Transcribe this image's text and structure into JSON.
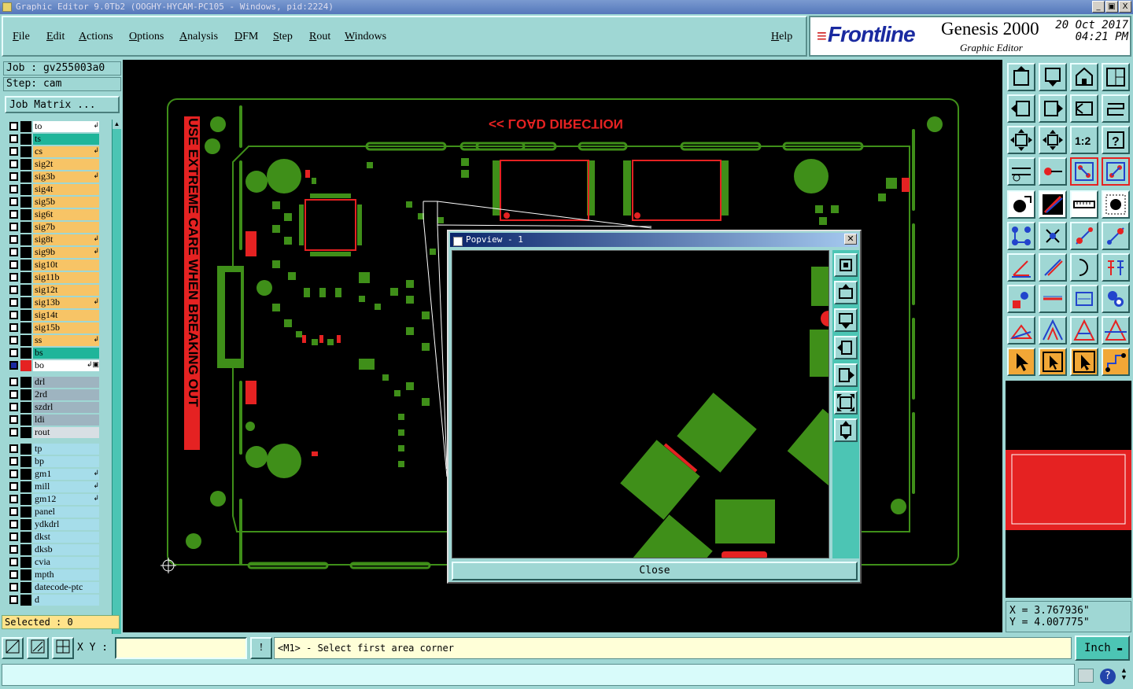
{
  "window": {
    "title": "Graphic Editor 9.0Tb2 (OOGHY-HYCAM-PC105 - Windows, pid:2224)",
    "buttons": [
      "_",
      "▣",
      "X"
    ]
  },
  "menu": {
    "items": [
      "File",
      "Edit",
      "Actions",
      "Options",
      "Analysis",
      "DFM",
      "Step",
      "Rout",
      "Windows"
    ],
    "help": "Help"
  },
  "brand": {
    "logo": "Frontline",
    "product": "Genesis 2000",
    "subtitle": "Graphic Editor",
    "date": "20 Oct 2017",
    "time": "04:21 PM"
  },
  "left": {
    "job": "Job : gv255003a0",
    "step": "Step: cam",
    "job_matrix": "Job Matrix ...",
    "selected": "Selected : 0"
  },
  "layers": [
    {
      "name": "to",
      "color": "#ffffff",
      "mark": "↲"
    },
    {
      "name": "ts",
      "color": "#1fb59a",
      "mark": ""
    },
    {
      "name": "cs",
      "color": "#f7c466",
      "mark": "↲"
    },
    {
      "name": "sig2t",
      "color": "#f7c466",
      "mark": ""
    },
    {
      "name": "sig3b",
      "color": "#f7c466",
      "mark": "↲"
    },
    {
      "name": "sig4t",
      "color": "#f7c466",
      "mark": ""
    },
    {
      "name": "sig5b",
      "color": "#f7c466",
      "mark": ""
    },
    {
      "name": "sig6t",
      "color": "#f7c466",
      "mark": ""
    },
    {
      "name": "sig7b",
      "color": "#f7c466",
      "mark": ""
    },
    {
      "name": "sig8t",
      "color": "#f7c466",
      "mark": "↲"
    },
    {
      "name": "sig9b",
      "color": "#f7c466",
      "mark": "↲"
    },
    {
      "name": "sig10t",
      "color": "#f7c466",
      "mark": ""
    },
    {
      "name": "sig11b",
      "color": "#f7c466",
      "mark": ""
    },
    {
      "name": "sig12t",
      "color": "#f7c466",
      "mark": ""
    },
    {
      "name": "sig13b",
      "color": "#f7c466",
      "mark": "↲"
    },
    {
      "name": "sig14t",
      "color": "#f7c466",
      "mark": ""
    },
    {
      "name": "sig15b",
      "color": "#f7c466",
      "mark": ""
    },
    {
      "name": "ss",
      "color": "#f7c466",
      "mark": "↲"
    },
    {
      "name": "bs",
      "color": "#1fb59a",
      "mark": ""
    },
    {
      "name": "bo",
      "color": "#ffffff",
      "mark": "↲▣"
    },
    {
      "name": "drl",
      "color": "#9eb4c0",
      "mark": ""
    },
    {
      "name": "2rd",
      "color": "#9eb4c0",
      "mark": ""
    },
    {
      "name": "szdrl",
      "color": "#9eb4c0",
      "mark": ""
    },
    {
      "name": "ldi",
      "color": "#9eb4c0",
      "mark": ""
    },
    {
      "name": "rout",
      "color": "#d8dfe4",
      "mark": ""
    },
    {
      "name": "tp",
      "color": "#a6ddea",
      "mark": ""
    },
    {
      "name": "bp",
      "color": "#a6ddea",
      "mark": ""
    },
    {
      "name": "gm1",
      "color": "#a6ddea",
      "mark": "↲"
    },
    {
      "name": "mill",
      "color": "#a6ddea",
      "mark": "↲"
    },
    {
      "name": "gm12",
      "color": "#a6ddea",
      "mark": "↲"
    },
    {
      "name": "panel",
      "color": "#a6ddea",
      "mark": ""
    },
    {
      "name": "ydkdrl",
      "color": "#a6ddea",
      "mark": ""
    },
    {
      "name": "dkst",
      "color": "#a6ddea",
      "mark": ""
    },
    {
      "name": "dksb",
      "color": "#a6ddea",
      "mark": ""
    },
    {
      "name": "cvia",
      "color": "#a6ddea",
      "mark": ""
    },
    {
      "name": "mpth",
      "color": "#a6ddea",
      "mark": ""
    },
    {
      "name": "datecode-ptc",
      "color": "#a6ddea",
      "mark": ""
    },
    {
      "name": "d",
      "color": "#a6ddea",
      "mark": ""
    }
  ],
  "canvas": {
    "load_direction": "<< LOAD DIRECTION",
    "side_text": "USE EXTREME CARE WHEN BREAKING OUT"
  },
  "popview": {
    "title": "Popview - 1",
    "close": "Close"
  },
  "coords": {
    "x": "X = 3.767936\"",
    "y": "Y = 4.007775\""
  },
  "bottom": {
    "xy_label": "X Y :",
    "prompt": "<M1> - Select first area corner",
    "unit": "Inch"
  },
  "colors": {
    "panel": "#9fd7d4",
    "copper": "#3f8f19",
    "highlight": "#e52222"
  }
}
